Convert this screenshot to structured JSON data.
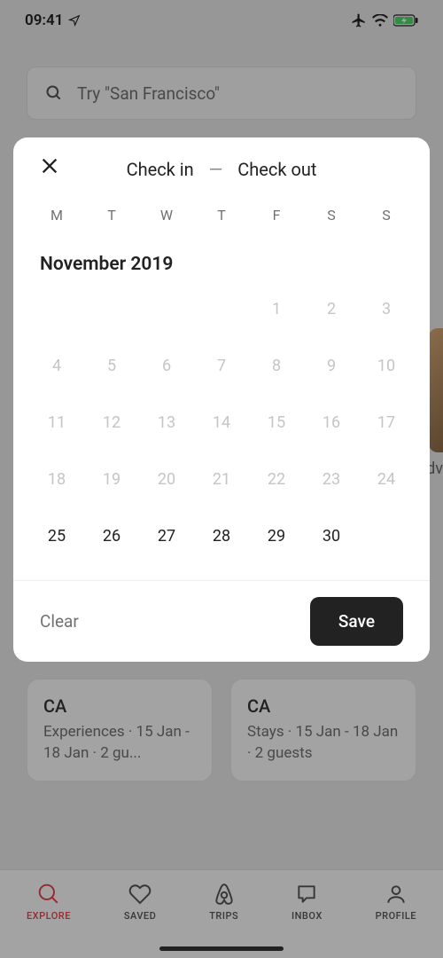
{
  "status": {
    "time": "09:41"
  },
  "search": {
    "placeholder": "Try \"San Francisco\""
  },
  "modal": {
    "title_checkin": "Check in",
    "title_dash": "—",
    "title_checkout": "Check out",
    "weekdays": [
      "M",
      "T",
      "W",
      "T",
      "F",
      "S",
      "S"
    ],
    "month_label": "November 2019",
    "days": [
      {
        "n": "",
        "empty": true
      },
      {
        "n": "",
        "empty": true
      },
      {
        "n": "",
        "empty": true
      },
      {
        "n": "",
        "empty": true
      },
      {
        "n": "1",
        "disabled": true
      },
      {
        "n": "2",
        "disabled": true
      },
      {
        "n": "3",
        "disabled": true
      },
      {
        "n": "4",
        "disabled": true
      },
      {
        "n": "5",
        "disabled": true
      },
      {
        "n": "6",
        "disabled": true
      },
      {
        "n": "7",
        "disabled": true
      },
      {
        "n": "8",
        "disabled": true
      },
      {
        "n": "9",
        "disabled": true
      },
      {
        "n": "10",
        "disabled": true
      },
      {
        "n": "11",
        "disabled": true
      },
      {
        "n": "12",
        "disabled": true
      },
      {
        "n": "13",
        "disabled": true
      },
      {
        "n": "14",
        "disabled": true
      },
      {
        "n": "15",
        "disabled": true
      },
      {
        "n": "16",
        "disabled": true
      },
      {
        "n": "17",
        "disabled": true
      },
      {
        "n": "18",
        "disabled": true
      },
      {
        "n": "19",
        "disabled": true
      },
      {
        "n": "20",
        "disabled": true
      },
      {
        "n": "21",
        "disabled": true
      },
      {
        "n": "22",
        "disabled": true
      },
      {
        "n": "23",
        "disabled": true
      },
      {
        "n": "24",
        "disabled": true
      },
      {
        "n": "25"
      },
      {
        "n": "26"
      },
      {
        "n": "27"
      },
      {
        "n": "28"
      },
      {
        "n": "29"
      },
      {
        "n": "30"
      },
      {
        "n": "",
        "empty": true
      }
    ],
    "clear_label": "Clear",
    "save_label": "Save"
  },
  "cards": [
    {
      "title": "CA",
      "subtitle": "Experiences · 15 Jan - 18 Jan · 2 gu..."
    },
    {
      "title": "CA",
      "subtitle": "Stays · 15 Jan - 18 Jan · 2 guests"
    }
  ],
  "peek_text": "dv",
  "nav": {
    "items": [
      {
        "label": "EXPLORE"
      },
      {
        "label": "SAVED"
      },
      {
        "label": "TRIPS"
      },
      {
        "label": "INBOX"
      },
      {
        "label": "PROFILE"
      }
    ]
  }
}
